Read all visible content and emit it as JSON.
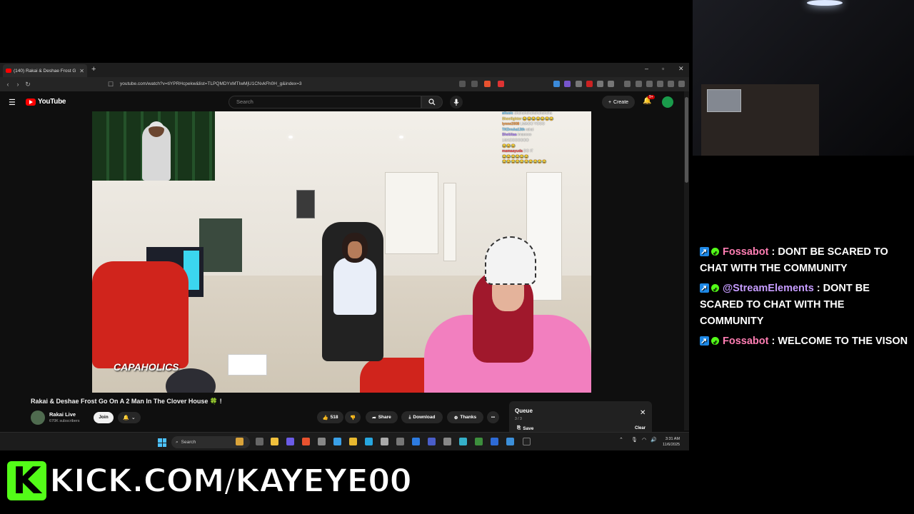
{
  "browser": {
    "tab_title": "(140) Rakai & Deshae Frost G",
    "newtab": "+",
    "win_min": "–",
    "win_max": "▫",
    "win_close": "✕",
    "url": "youtube.com/watch?v=tiYPRHcpekw&list=TLPQMDYxMTIwMjU1CNvkFh0H_g&index=3"
  },
  "youtube": {
    "logo": "YouTube",
    "search_placeholder": "Search",
    "create_label": "Create",
    "notif_count": "9+",
    "video_title": "Rakai & Deshae Frost Go On A 2 Man In The Clover House 🍀 !",
    "channel_name": "Rakai Live",
    "subscribers": "670K subscribers",
    "join_label": "Join",
    "like_count": "518",
    "share_label": "Share",
    "download_label": "Download",
    "thanks_label": "Thanks",
    "more_label": "•••",
    "queue": {
      "title": "Queue",
      "count": "3 / 3",
      "save_label": "Save",
      "clear_label": "Clear"
    }
  },
  "video_overlay": {
    "watermark": "CAPAHOLICS",
    "chat": [
      {
        "user": "aitusic",
        "text": "ahahahahahahahahaha",
        "color": "#7fd3ff"
      },
      {
        "user": "Sheefighter",
        "text": "😂😂😂😂😂😂😂",
        "color": "#ffe066"
      },
      {
        "user": "lynne2008",
        "text": "LMAOO YOOO",
        "color": "#ff9f43"
      },
      {
        "user": "TKDrnAa13th",
        "text": "rakai",
        "color": "#7fd3ff"
      },
      {
        "user": "Shekitaa",
        "text": "lmaoooo",
        "color": "#b388ff"
      },
      {
        "user": "",
        "text": "LMAOOOOOOO",
        "color": "#ff6b9d"
      },
      {
        "user": "",
        "text": "😂😂😂",
        "color": "#b388ff"
      },
      {
        "user": "mamaayuda",
        "text": "DO IT",
        "color": "#ff5252"
      },
      {
        "user": "",
        "text": "😂😂😂😂😂😂",
        "color": "#7fd3ff"
      },
      {
        "user": "",
        "text": "😂😂😂😂😂😂😂😂😂😂",
        "color": "#66bb6a"
      }
    ]
  },
  "taskbar": {
    "search_placeholder": "Search",
    "time": "3:31 AM",
    "date": "11/6/2025"
  },
  "stream_chat": [
    {
      "user": "Fossabot",
      "user_color": "#ff7eb3",
      "text": " : DONT BE SCARED TO CHAT WITH THE COMMUNITY"
    },
    {
      "user": "@StreamElements",
      "user_color": "#c69cff",
      "text": " : DONT BE SCARED TO CHAT WITH THE COMMUNITY"
    },
    {
      "user": "Fossabot",
      "user_color": "#ff7eb3",
      "text": " : WELCOME TO THE VISON"
    }
  ],
  "banner": {
    "logo_letter": "K",
    "text": "KICK.COM/KAYEYE00"
  },
  "colors": {
    "kick_green": "#53fc18",
    "yt_red": "#ff0000",
    "yt_bg": "#0f0f0f"
  }
}
